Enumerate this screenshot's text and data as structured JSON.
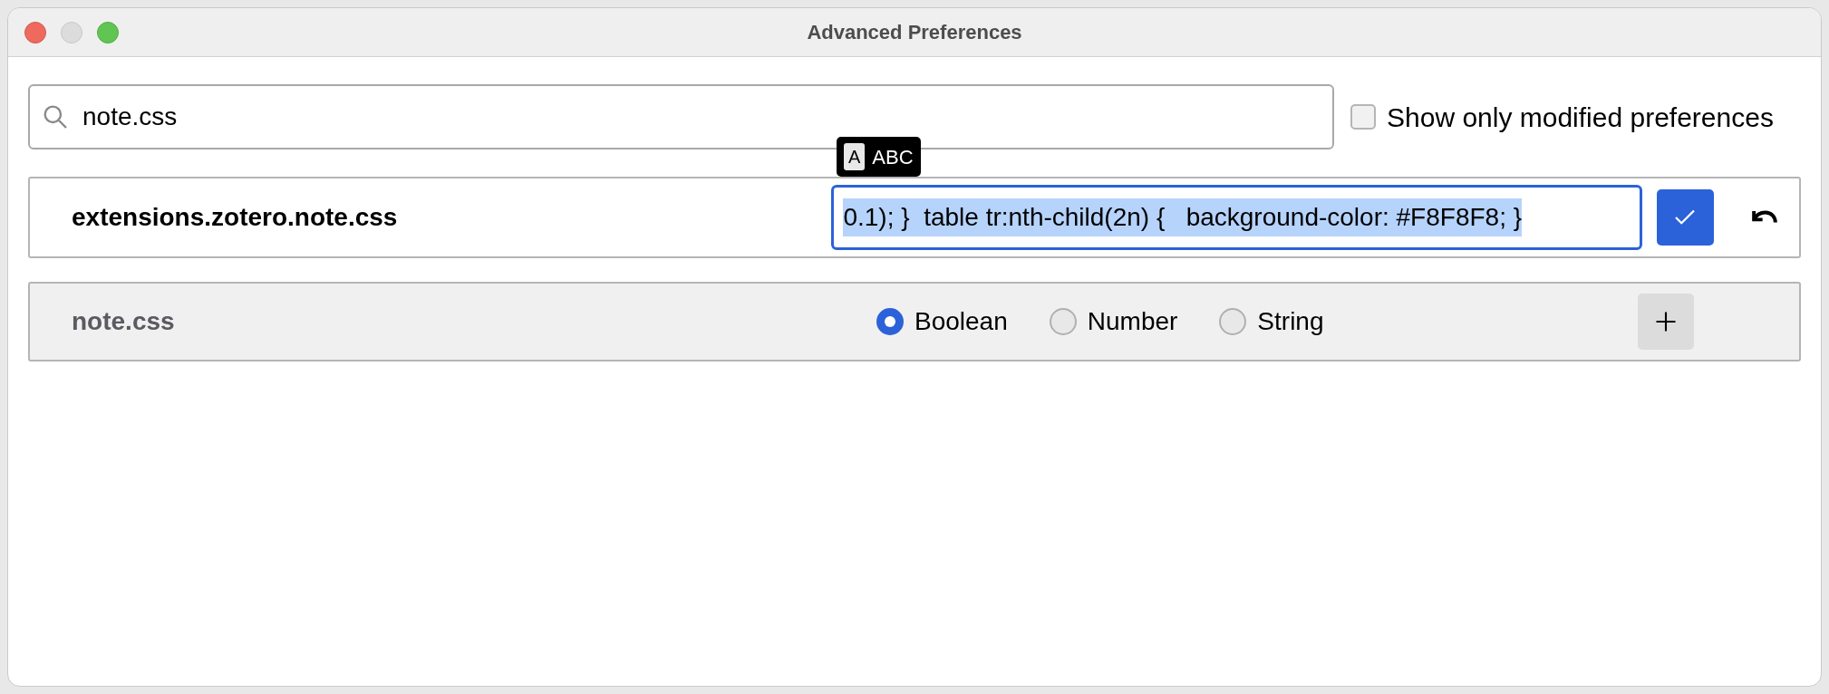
{
  "window": {
    "title": "Advanced Preferences"
  },
  "search": {
    "value": "note.css"
  },
  "show_only_modified": {
    "label": "Show only modified preferences",
    "checked": false
  },
  "input_source_tooltip": {
    "key": "A",
    "label": "ABC"
  },
  "edit_row": {
    "name": "extensions.zotero.note.css",
    "value": "0.1); }  table tr:nth-child(2n) {   background-color: #F8F8F8; }",
    "value_selected": true
  },
  "new_row": {
    "name": "note.css",
    "types": [
      {
        "label": "Boolean",
        "selected": true
      },
      {
        "label": "Number",
        "selected": false
      },
      {
        "label": "String",
        "selected": false
      }
    ]
  }
}
